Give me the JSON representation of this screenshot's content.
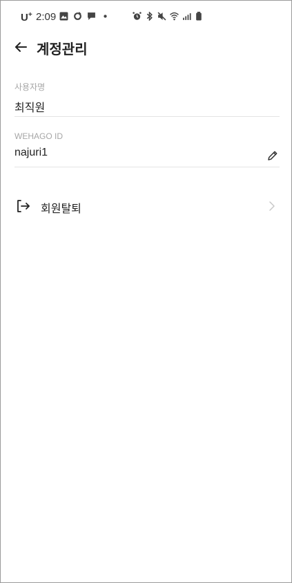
{
  "status_bar": {
    "carrier": "U",
    "carrier_sup": "+",
    "time": "2:09"
  },
  "header": {
    "title": "계정관리"
  },
  "fields": {
    "username": {
      "label": "사용자명",
      "value": "최직원"
    },
    "id": {
      "label": "WEHAGO ID",
      "value": "najuri1"
    }
  },
  "actions": {
    "withdraw_label": "회원탈퇴"
  },
  "icons": {
    "back": "arrow-left-icon",
    "edit": "pencil-icon",
    "withdraw": "logout-icon",
    "chevron": "chevron-right-icon"
  },
  "colors": {
    "text": "#222222",
    "label": "#a6a6a6",
    "divider": "#e3e3e3",
    "chevron": "#c8c8c8"
  }
}
